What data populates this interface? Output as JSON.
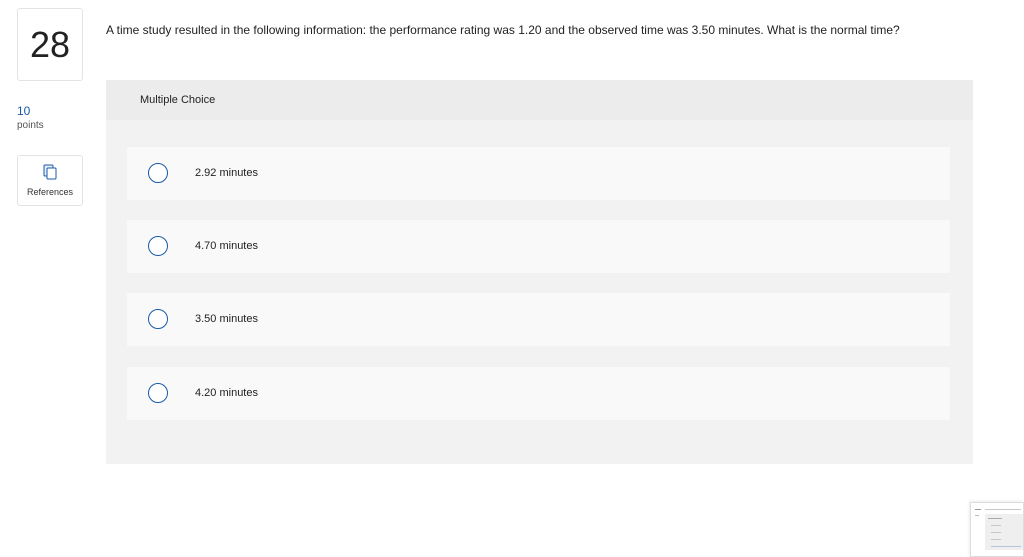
{
  "question": {
    "number": "28",
    "points_value": "10",
    "points_label": "points",
    "text": "A time study resulted in the following information: the performance rating was 1.20 and the observed time was 3.50 minutes. What is the normal time?"
  },
  "references": {
    "label": "References",
    "icon": "copy-icon"
  },
  "multiple_choice": {
    "title": "Multiple Choice",
    "options": [
      {
        "label": "2.92 minutes",
        "selected": false
      },
      {
        "label": "4.70 minutes",
        "selected": false
      },
      {
        "label": "3.50 minutes",
        "selected": false
      },
      {
        "label": "4.20 minutes",
        "selected": false
      }
    ]
  },
  "colors": {
    "accent": "#1a5aa8",
    "panel_bg": "#f2f2f2",
    "option_bg": "#f9f9f9"
  }
}
